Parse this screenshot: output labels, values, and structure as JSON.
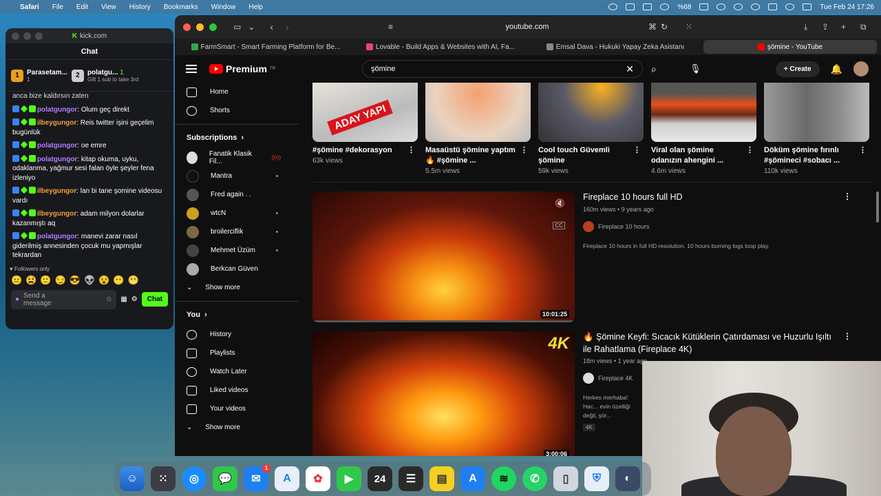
{
  "menubar": {
    "items": [
      "Safari",
      "File",
      "Edit",
      "View",
      "History",
      "Bookmarks",
      "Window",
      "Help"
    ],
    "battery": "%68",
    "clock": "Tue Feb 24  17:26"
  },
  "kick": {
    "url": "kick.com",
    "chat_title": "Chat",
    "pinned": [
      {
        "name": "Parasetam...",
        "count": "1"
      },
      {
        "name": "polatgu...",
        "count": "1",
        "sub": "Gift 1 sub to take 3rd"
      }
    ],
    "partial_top": "anca bize kaldırsın zaten",
    "messages": [
      {
        "user": "polatgungor",
        "text": "Olum geç direkt",
        "color": "u1"
      },
      {
        "user": "ilbeygungor",
        "text": "Reis twitter işini geçelim bugünlük",
        "color": "u2"
      },
      {
        "user": "polatgungor",
        "text": "oe emre",
        "color": "u1"
      },
      {
        "user": "polatgungor",
        "text": "kitap okuma, uyku, odaklanma, yağmur sesi falan öyle şeyler fena izleniyo",
        "color": "u1"
      },
      {
        "user": "ilbeygungor",
        "text": "lan bi tane şomine videosu vardı",
        "color": "u2"
      },
      {
        "user": "ilbeygungor",
        "text": "adam milyon dolarlar kazanmıştı aq",
        "color": "u2"
      },
      {
        "user": "polatgungor",
        "text": "manevi zarar nasıl giderilmiş annesinden çocuk mu yapmışlar tekrardan",
        "color": "u1"
      }
    ],
    "followers_only": "Followers only",
    "send_placeholder": "Send a message",
    "chat_button": "Chat"
  },
  "safari": {
    "url": "youtube.com",
    "tabs": [
      {
        "label": "FarmSmart - Smart Farming Platform for Be...",
        "color": "#2fa84f"
      },
      {
        "label": "Lovable - Build Apps & Websites with AI, Fa...",
        "color": "#e8447a"
      },
      {
        "label": "Emsal Dava - Hukuki Yapay Zeka Asistanı",
        "color": "#888888"
      },
      {
        "label": "şömine - YouTube",
        "color": "#ff0000"
      }
    ]
  },
  "youtube": {
    "logo": "Premium",
    "logo_sup": "TR",
    "search_value": "şömine",
    "create": "Create",
    "sidebar": {
      "top": [
        "Home",
        "Shorts"
      ],
      "subscriptions_title": "Subscriptions",
      "channels": [
        "Fanatik Klasik Fil...",
        "Mantra",
        "Fred again . .",
        "wtcN",
        "broilerciflik",
        "Mehmet Üzüm",
        "Berkcan Güven"
      ],
      "show_more": "Show more",
      "you_title": "You",
      "you_items": [
        "History",
        "Playlists",
        "Watch Later",
        "Liked videos",
        "Your videos"
      ],
      "show_more2": "Show more"
    },
    "shorts": [
      {
        "title": "#şömine #dekorasyon",
        "views": "63k views",
        "overlay": "ADAY YAPI"
      },
      {
        "title": "Masaüstü şömine yaptım 🔥 #şömine ...",
        "views": "5.5m views"
      },
      {
        "title": "Cool touch Güvemli şömine",
        "views": "59k views"
      },
      {
        "title": "Viral olan şömine odanızın ahengini ...",
        "views": "4.6m views"
      },
      {
        "title": "Döküm şömine fırınlı #şömineci #sobacı ...",
        "views": "110k views"
      }
    ],
    "videos": [
      {
        "title": "Fireplace 10 hours full HD",
        "views": "160m views",
        "age": "9 years ago",
        "channel": "Fireplace 10 hours",
        "desc": "Fireplace 10 hours in full HD resolution. 10 hours burning logs loop play.",
        "duration": "10:01:25",
        "cc": "CC"
      },
      {
        "title": "🔥 Şömine Keyfi: Sıcacık Kütüklerin Çatırdaması ve Huzurlu Işıltı ile Rahatlama (Fireplace 4K)",
        "views": "18m views",
        "age": "1 year ago",
        "channel": "Fireplace 4K",
        "desc": "Herkes merhaba! Hac... evin özelliği değil, şör...",
        "duration": "3:00:06",
        "badge": "4K",
        "overlay": "4K"
      }
    ]
  },
  "dock": {
    "calendar_day": "24",
    "mail_badge": "1"
  }
}
